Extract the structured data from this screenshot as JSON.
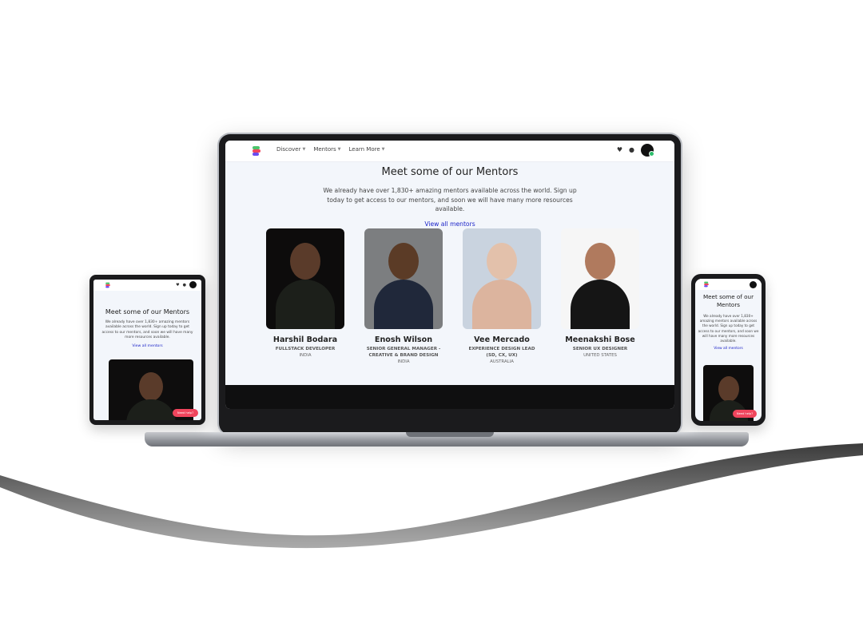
{
  "nav": {
    "links": [
      "Discover",
      "Mentors",
      "Learn More"
    ]
  },
  "section": {
    "title": "Meet some of our Mentors",
    "description": "We already have over 1,830+ amazing mentors available across the world. Sign up today to get access to our mentors, and soon we will have many more resources available.",
    "link": "View all mentors"
  },
  "mentors": [
    {
      "name": "Harshil Bodara",
      "role": "FULLSTACK DEVELOPER",
      "country": "INDIA"
    },
    {
      "name": "Enosh Wilson",
      "role": "SENIOR GENERAL MANAGER - CREATIVE & BRAND DESIGN",
      "country": "INDIA"
    },
    {
      "name": "Vee Mercado",
      "role": "EXPERIENCE DESIGN LEAD (SD, CX, UX)",
      "country": "AUSTRALIA"
    },
    {
      "name": "Meenakshi Bose",
      "role": "SENIOR UX DESIGNER",
      "country": "UNITED STATES"
    }
  ],
  "tablet": {
    "title": "Meet some of our Mentors",
    "description": "We already have over 1,830+ amazing mentors available across the world. Sign up today to get access to our mentors, and soon we will have many more resources available.",
    "link": "View all mentors",
    "help": "Need help?"
  },
  "phone": {
    "title": "Meet some of our Mentors",
    "description": "We already have over 1,830+ amazing mentors available across the world. Sign up today to get access to our mentors, and soon we will have many more resources available.",
    "link": "View all mentors",
    "help": "Need help?"
  },
  "colors": {
    "accent": "#1b23c8",
    "help": "#f0455d",
    "screen_bg": "#f3f6fb"
  }
}
